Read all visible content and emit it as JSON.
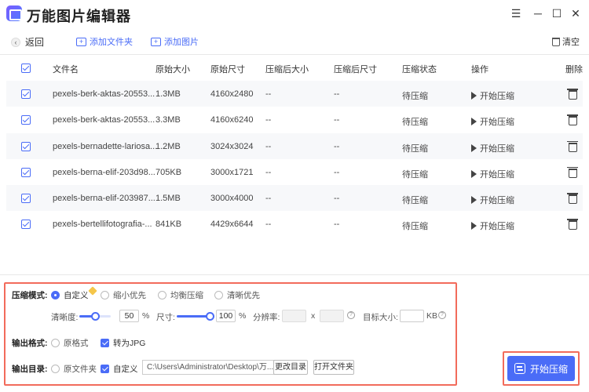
{
  "app": {
    "title": "万能图片编辑器"
  },
  "window": {
    "minimize": "─",
    "maximize": "☐",
    "close": "✕"
  },
  "toolbar": {
    "back_label": "返回",
    "add_folder_label": "添加文件夹",
    "add_image_label": "添加图片",
    "clear_label": "清空"
  },
  "table": {
    "headers": {
      "filename": "文件名",
      "orig_size": "原始大小",
      "orig_dim": "原始尺寸",
      "comp_size": "压缩后大小",
      "comp_dim": "压缩后尺寸",
      "status": "压缩状态",
      "action": "操作",
      "delete": "删除"
    },
    "rows": [
      {
        "name": "pexels-berk-aktas-20553...",
        "size": "1.3MB",
        "dim": "4160x2480",
        "csize": "--",
        "cdim": "--",
        "status": "待压缩",
        "action": "开始压缩"
      },
      {
        "name": "pexels-berk-aktas-20553...",
        "size": "3.3MB",
        "dim": "4160x6240",
        "csize": "--",
        "cdim": "--",
        "status": "待压缩",
        "action": "开始压缩"
      },
      {
        "name": "pexels-bernadette-lariosa...",
        "size": "1.2MB",
        "dim": "3024x3024",
        "csize": "--",
        "cdim": "--",
        "status": "待压缩",
        "action": "开始压缩"
      },
      {
        "name": "pexels-berna-elif-203d98...",
        "size": "705KB",
        "dim": "3000x1721",
        "csize": "--",
        "cdim": "--",
        "status": "待压缩",
        "action": "开始压缩"
      },
      {
        "name": "pexels-berna-elif-203987...",
        "size": "1.5MB",
        "dim": "3000x4000",
        "csize": "--",
        "cdim": "--",
        "status": "待压缩",
        "action": "开始压缩"
      },
      {
        "name": "pexels-bertellifotografia-...",
        "size": "841KB",
        "dim": "4429x6644",
        "csize": "--",
        "cdim": "--",
        "status": "待压缩",
        "action": "开始压缩"
      }
    ]
  },
  "settings": {
    "mode_label": "压缩模式:",
    "mode_options": [
      "自定义",
      "缩小优先",
      "均衡压缩",
      "清晰优先"
    ],
    "mode_selected": "自定义",
    "clarity_label": "清晰度:",
    "clarity_value": "50",
    "clarity_unit": "%",
    "clarity_level": 0.5,
    "size_label": "尺寸:",
    "size_value": "100",
    "size_unit": "%",
    "size_level": 1.0,
    "resolution_label": "分辨率:",
    "resolution_x": "x",
    "target_label": "目标大小:",
    "target_unit": "KB",
    "format_label": "输出格式:",
    "format_options": [
      "原格式",
      "转为JPG"
    ],
    "format_selected": "转为JPG",
    "dir_label": "输出目录:",
    "dir_options": [
      "原文件夹",
      "自定义"
    ],
    "dir_selected": "自定义",
    "dir_path": "C:\\Users\\Administrator\\Desktop\\万...",
    "change_dir_label": "更改目录",
    "open_folder_label": "打开文件夹"
  },
  "start_button": {
    "label": "开始压缩"
  },
  "colors": {
    "accent": "#4a6cf7",
    "highlight": "#f26b5b"
  }
}
